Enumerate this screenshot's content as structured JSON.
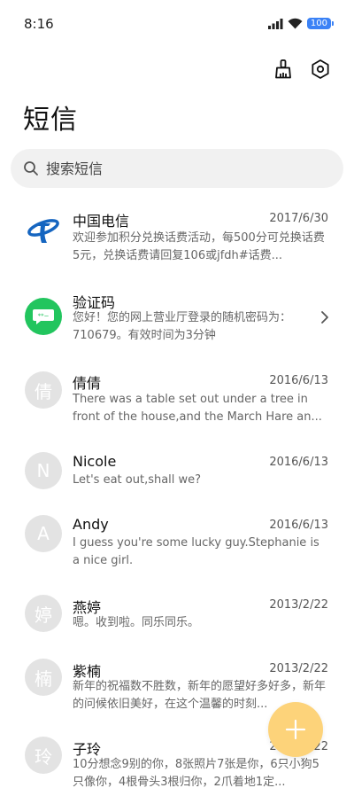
{
  "status": {
    "time": "8:16",
    "battery": "100"
  },
  "header": {
    "title": "短信",
    "clean_icon": "broom-icon",
    "settings_icon": "settings-icon"
  },
  "search": {
    "placeholder": "搜索短信",
    "icon": "search-icon"
  },
  "messages": [
    {
      "name": "中国电信",
      "date": "2017/6/30",
      "preview": "欢迎参加积分兑换话费活动，每500分可兑换话费5元，兑换话费请回复106或jfdh#话费...",
      "avatar_type": "telecom-logo"
    },
    {
      "name": "验证码",
      "date": "",
      "preview": "您好！您的网上营业厅登录的随机密码为：710679。有效时间为3分钟",
      "avatar_type": "verification-code"
    },
    {
      "name": "倩倩",
      "date": "2016/6/13",
      "preview": "There was a table set out under a tree in front of the house,and the March Hare an...",
      "avatar_letter": "倩"
    },
    {
      "name": "Nicole",
      "date": "2016/6/13",
      "preview": "Let's eat out,shall we?",
      "avatar_letter": "N"
    },
    {
      "name": "Andy",
      "date": "2016/6/13",
      "preview": "I guess you're some lucky guy.Stephanie is a nice girl.",
      "avatar_letter": "A"
    },
    {
      "name": "燕婷",
      "date": "2013/2/22",
      "preview": "嗯。收到啦。同乐同乐。",
      "avatar_letter": "婷"
    },
    {
      "name": "紫楠",
      "date": "2013/2/22",
      "preview": "新年的祝福数不胜数，新年的愿望好多好多，新年的问候依旧美好，在这个温馨的时刻...",
      "avatar_letter": "楠"
    },
    {
      "name": "子玲",
      "date": "2013/2/22",
      "preview": "10分想念9别的你，8张照片7张是你，6只小狗5只像你，4根骨头3根归你，2爪着地1定...",
      "avatar_letter": "玲"
    }
  ],
  "fab": {
    "icon": "plus-icon"
  },
  "colors": {
    "accent": "#fdd37a",
    "avatar_gray": "#e3e3e3",
    "green_avatar": "#22c55e",
    "battery": "#3b82f6"
  }
}
